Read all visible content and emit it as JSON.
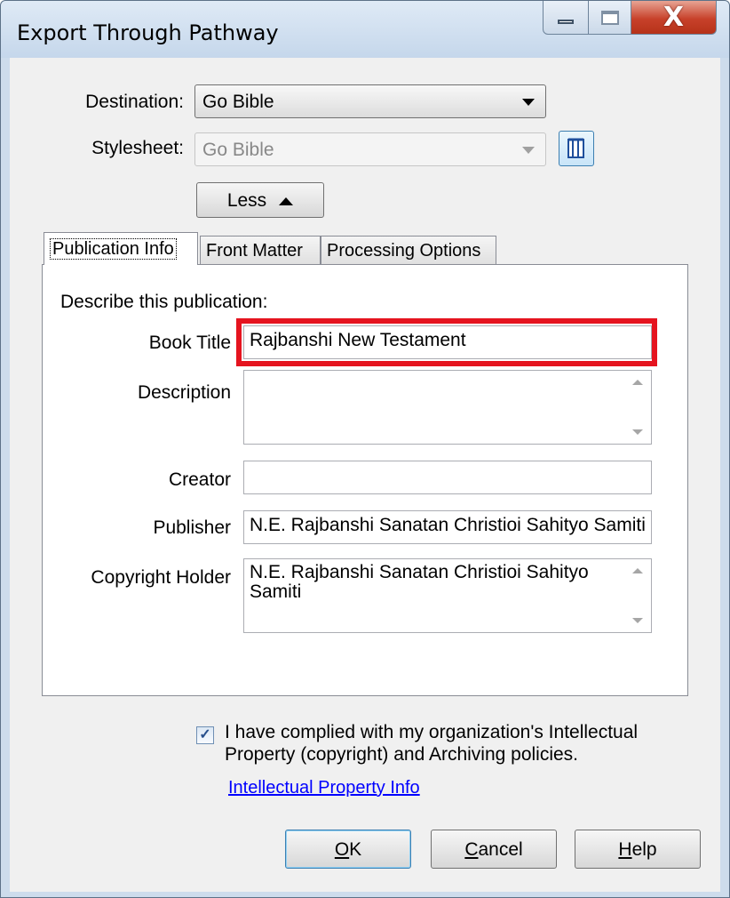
{
  "window": {
    "title": "Export Through Pathway",
    "controls": {
      "minimize_icon": "minimize-icon",
      "maximize_icon": "maximize-icon",
      "close_icon": "close-icon",
      "close_glyph": "X"
    }
  },
  "destination": {
    "label": "Destination:",
    "value": "Go Bible"
  },
  "stylesheet": {
    "label": "Stylesheet:",
    "value": "Go Bible",
    "edit_icon": "book-icon"
  },
  "less_button": {
    "label": "Less"
  },
  "tabs": [
    {
      "label": "Publication Info",
      "active": true
    },
    {
      "label": "Front Matter",
      "active": false
    },
    {
      "label": "Processing Options",
      "active": false
    }
  ],
  "publication": {
    "heading": "Describe this publication:",
    "book_title": {
      "label": "Book Title",
      "value": "Rajbanshi New Testament"
    },
    "description": {
      "label": "Description",
      "value": ""
    },
    "creator": {
      "label": "Creator",
      "value": ""
    },
    "publisher": {
      "label": "Publisher",
      "value": "N.E. Rajbanshi Sanatan Christioi Sahityo Samiti"
    },
    "copyright_holder": {
      "label": "Copyright Holder",
      "value": "N.E. Rajbanshi Sanatan Christioi Sahityo Samiti"
    }
  },
  "compliance": {
    "checked": true,
    "text": "I have complied with my organization's Intellectual Property (copyright) and Archiving policies."
  },
  "ip_link": "Intellectual Property Info",
  "buttons": {
    "ok": {
      "mnemonic": "O",
      "rest": "K"
    },
    "cancel": {
      "mnemonic": "C",
      "rest": "ancel"
    },
    "help": {
      "mnemonic": "H",
      "rest": "elp"
    }
  },
  "colors": {
    "highlight": "#e5141f",
    "link": "#0000ff",
    "chrome": "#cddcec",
    "face": "#f0f0f0"
  }
}
